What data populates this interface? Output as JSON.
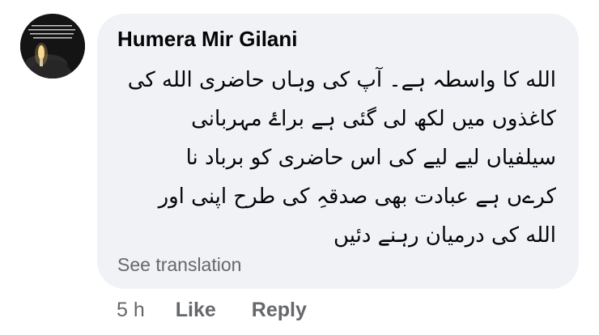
{
  "comment": {
    "author": "Humera Mir Gilani",
    "lines": [
      "الله کا واسطہ ہے۔  آپ کی وہاں حاضری الله کی",
      "کاغذوں میں لکھ لی گئی ہے براۓ مہربانی",
      "سیلفیاں لیے لیے کی اس حاضری کو برباد نا",
      "کرےں ہے عبادت بھی صدقہِ کی طرح اپنی اور",
      "الله کی درمیان رہنے دئیں"
    ],
    "see_translation": "See translation",
    "time": "5 h",
    "like_label": "Like",
    "reply_label": "Reply"
  },
  "colors": {
    "bubble": "#f0f2f5",
    "text": "#050505",
    "secondary": "#65676b"
  },
  "icons": {
    "avatar": "candle-photo-avatar"
  }
}
